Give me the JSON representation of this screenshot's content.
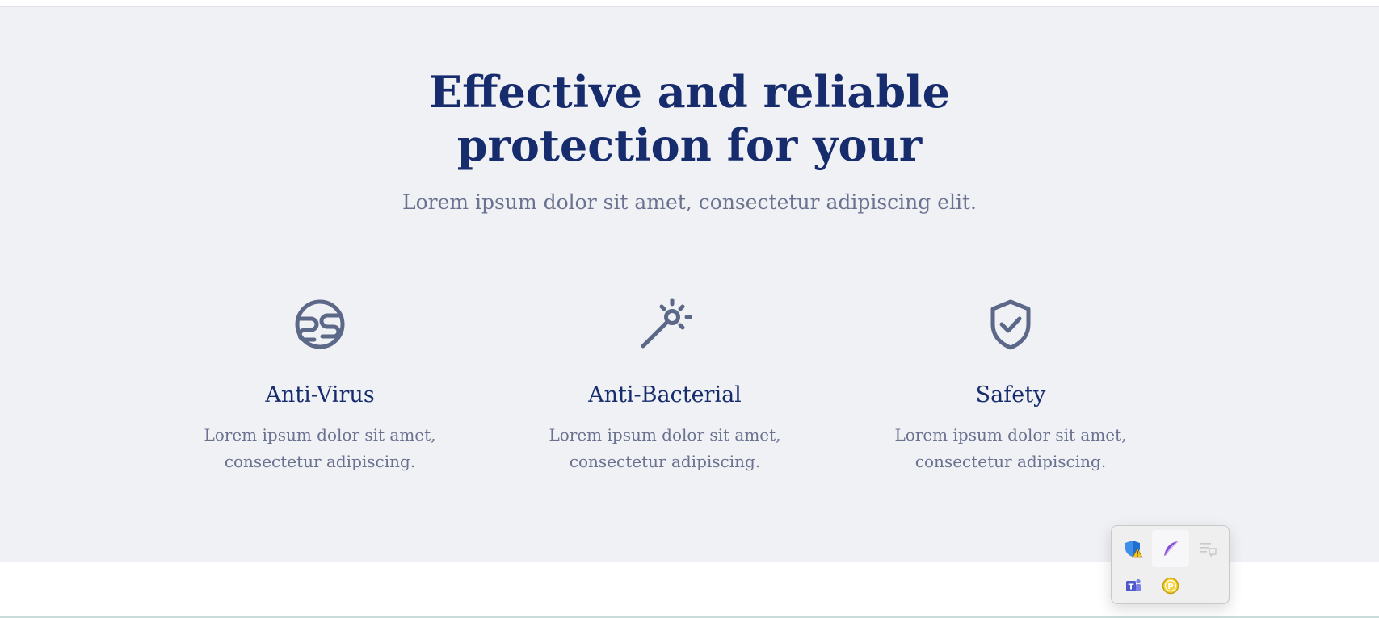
{
  "hero": {
    "title_line1": "Effective and reliable",
    "title_line2": "protection for your",
    "subtitle": "Lorem ipsum dolor sit amet, consectetur adipiscing elit."
  },
  "features": [
    {
      "icon": "globe-icon",
      "title": "Anti-Virus",
      "text_line1": "Lorem ipsum dolor sit amet,",
      "text_line2": "consectetur adipiscing."
    },
    {
      "icon": "magic-wand-icon",
      "title": "Anti-Bacterial",
      "text_line1": "Lorem ipsum dolor sit amet,",
      "text_line2": "consectetur adipiscing."
    },
    {
      "icon": "shield-check-icon",
      "title": "Safety",
      "text_line1": "Lorem ipsum dolor sit amet,",
      "text_line2": "consectetur adipiscing."
    }
  ],
  "tray": {
    "icons": [
      "windows-security-warning-icon",
      "feather-pen-icon",
      "notification-list-icon",
      "teams-icon",
      "p-coin-icon"
    ]
  },
  "colors": {
    "heading": "#172c6d",
    "body_text": "#6a7290",
    "icon": "#5c6888",
    "section_bg": "#f0f1f5"
  }
}
